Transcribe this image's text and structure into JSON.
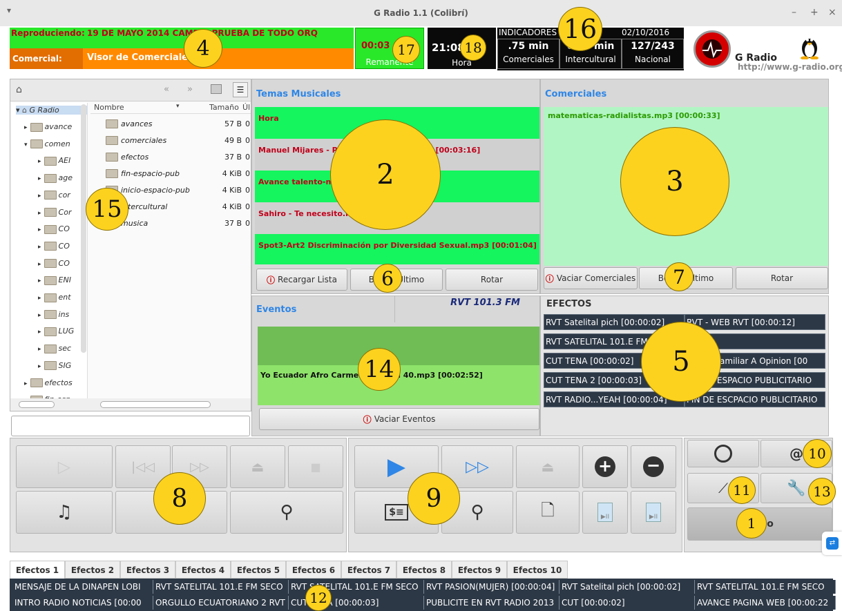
{
  "window": {
    "title": "G Radio 1.1 (Colibrí)",
    "menu_glyph": "▾",
    "min": "–",
    "max": "+",
    "close": "×"
  },
  "status": {
    "playing_label": "Reproduciendo:",
    "playing_value": "19 DE MAYO 2014 CAMBIA PRUEBA DE TODO ORQ",
    "commercial_label": "Comercial:",
    "commercial_value": "Visor de Comerciales"
  },
  "remaining": {
    "value": "00:03",
    "label": "Remanente"
  },
  "clock": {
    "value": "21:08:58",
    "label": "Hora"
  },
  "indicators": {
    "title": "INDICADORES",
    "date": "02/10/2016",
    "items": [
      {
        "value": ".75 min",
        "label": "Comerciales"
      },
      {
        "value": "0.00 min",
        "label": "Intercultural"
      },
      {
        "value": "127/243",
        "label": "Nacional"
      }
    ]
  },
  "brand": {
    "name": "G Radio",
    "url": "http://www.g-radio.org"
  },
  "browser": {
    "columns": [
      "Nombre",
      "Tamaño",
      "Úl"
    ],
    "tree_root": "G Radio",
    "tree": [
      "avance",
      "comen",
      "AEI",
      "age",
      "cor",
      "Cor",
      "CO",
      "CO",
      "CO",
      "ENI",
      "ent",
      "ins",
      "LUG",
      "sec",
      "SIG",
      "efectos",
      "fin-esp"
    ],
    "files": [
      {
        "name": "avances",
        "size": "57 B",
        "extra": "0"
      },
      {
        "name": "comerciales",
        "size": "49 B",
        "extra": "0"
      },
      {
        "name": "efectos",
        "size": "37 B",
        "extra": "0"
      },
      {
        "name": "fin-espacio-pub",
        "size": "4 KiB",
        "extra": "0"
      },
      {
        "name": "inicio-espacio-pub",
        "size": "4 KiB",
        "extra": "0"
      },
      {
        "name": "intercultural",
        "size": "4 KiB",
        "extra": "0"
      },
      {
        "name": "musica",
        "size": "37 B",
        "extra": "0"
      }
    ]
  },
  "music": {
    "title": "Temas Musicales",
    "rows": [
      "Hora",
      "Manuel Mijares - Para amarnos mas.mp3 [00:03:16]",
      "Avance talento-nacional.mp3",
      "Sahiro - Te necesito.mp3",
      "Spot3-Art2 Discriminación por Diversidad Sexual.mp3 [00:01:04]"
    ],
    "buttons": [
      "Recargar Lista",
      "Borrar Último",
      "Rotar"
    ]
  },
  "commercials": {
    "title": "Comerciales",
    "rows": [
      "matematicas-radialistas.mp3 [00:00:33]"
    ],
    "buttons": [
      "Vaciar Comerciales",
      "Borrar Último",
      "Rotar"
    ]
  },
  "events": {
    "title": "Eventos",
    "station": "RVT 101.3 FM",
    "rows": [
      "Yo Ecuador Afro Carmen Capsula 40.mp3 [00:02:52]"
    ],
    "button": "Vaciar Eventos"
  },
  "effects": {
    "title": "EFECTOS",
    "cells": [
      [
        "RVT Satelital pich [00:00:02]",
        "RVT - WEB RVT [00:00:12]"
      ],
      [
        "RVT SATELITAL 101.E FM SECO",
        ""
      ],
      [
        "CUT TENA [00:00:02]",
        "Nuevo Familiar A Opinion [00"
      ],
      [
        "CUT TENA 2 [00:00:03]",
        "FIN DE ESPACIO PUBLICITARIO"
      ],
      [
        "RVT RADIO...YEAH [00:00:04]",
        "FIN DE ESCPACIO PUBLICITARIO"
      ]
    ]
  },
  "tabs": [
    "Efectos 1",
    "Efectos 2",
    "Efectos 3",
    "Efectos 4",
    "Efectos 5",
    "Efectos 6",
    "Efectos 7",
    "Efectos 8",
    "Efectos 9",
    "Efectos 10"
  ],
  "bottom_rows": [
    [
      "MENSAJE DE LA DINAPEN LOBI",
      "RVT SATELITAL 101.E FM SECO",
      "RVT SATELITAL 101.E FM SECO",
      "RVT PASION(MUJER) [00:00:04]",
      "RVT Satelital pich [00:00:02]",
      "RVT SATELITAL 101.E FM SECO"
    ],
    [
      "INTRO RADIO NOTICIAS [00:00",
      "ORGULLO ECUATORIANO 2 RVT",
      "CUT TENA [00:00:03]",
      "PUBLICITE EN RVT RADIO 2013",
      "CUT [00:00:02]",
      "AVANCE PAGINA WEB [00:00:22"
    ]
  ],
  "misc": {
    "wide_btn_text": "o",
    "dollar": "$≡"
  },
  "callouts": [
    "1",
    "2",
    "3",
    "4",
    "5",
    "6",
    "7",
    "8",
    "9",
    "10",
    "11",
    "12",
    "13",
    "14",
    "15",
    "16",
    "17",
    "18"
  ],
  "colors": {
    "green": "#29e829",
    "orange": "#ff8a00",
    "blue_header": "#2f86e6",
    "red_text": "#c0001a",
    "effects_cell": "#2d3846",
    "callout": "#fcd21f"
  }
}
